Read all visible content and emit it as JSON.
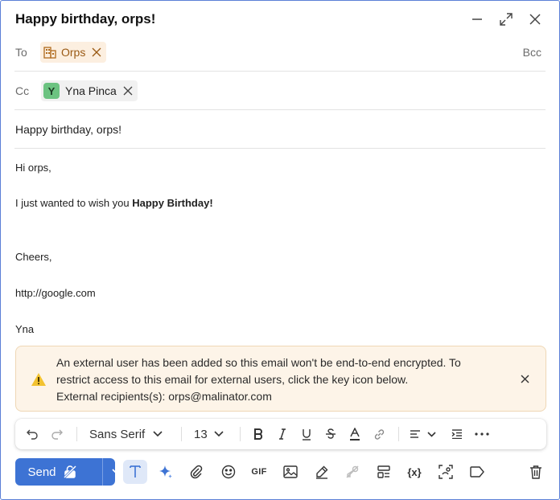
{
  "window": {
    "title": "Happy birthday, orps!"
  },
  "recipients": {
    "to_label": "To",
    "to_chip": {
      "name": "Orps"
    },
    "bcc_label": "Bcc",
    "cc_label": "Cc",
    "cc_chip": {
      "avatar_letter": "Y",
      "name": "Yna Pinca"
    }
  },
  "subject": "Happy birthday, orps!",
  "body": {
    "greeting": "Hi orps,",
    "line_prefix": "I just wanted to wish you ",
    "line_bold": "Happy Birthday!",
    "closing": "Cheers,",
    "link": "http://google.com",
    "signature": "Yna"
  },
  "banner": {
    "line1": "An external user has been added so this email won't be end-to-end encrypted. To",
    "line2": "restrict access to this email for external users, click the key icon below.",
    "line3": "External recipients(s): orps@malinator.com"
  },
  "format_toolbar": {
    "font_family": "Sans Serif",
    "font_size": "13"
  },
  "bottom_bar": {
    "send_label": "Send",
    "gif_label": "GIF",
    "variables_label": "{x}"
  },
  "colors": {
    "accent": "#3d73d4",
    "banner_bg": "#fdf4e8",
    "cc_avatar": "#6cc381",
    "to_chip_bg": "#fcefe0"
  }
}
